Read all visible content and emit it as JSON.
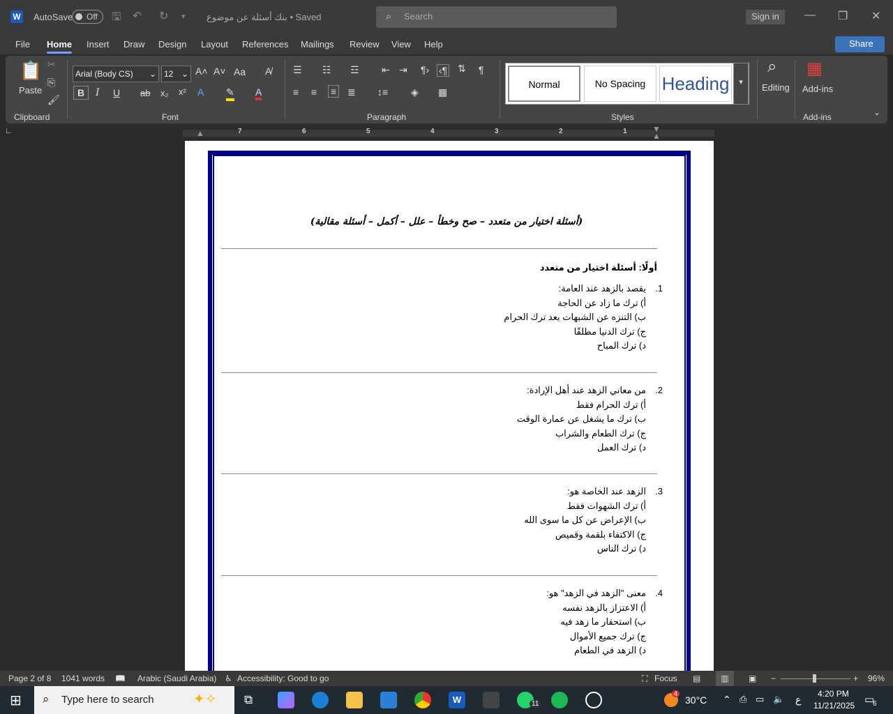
{
  "titlebar": {
    "autosave": "AutoSave",
    "toggle": "Off",
    "doc_title": "بنك أسئلة عن موضوع • Saved",
    "search_placeholder": "Search",
    "signin": "Sign in"
  },
  "menu": [
    "File",
    "Home",
    "Insert",
    "Draw",
    "Design",
    "Layout",
    "References",
    "Mailings",
    "Review",
    "View",
    "Help"
  ],
  "share": "Share",
  "ribbon": {
    "clipboard": {
      "label": "Clipboard",
      "paste": "Paste"
    },
    "font": {
      "label": "Font",
      "family": "Arial (Body CS)",
      "size": "12",
      "bold": "B",
      "italic": "I",
      "underline": "U",
      "strike": "ab",
      "sub": "x₂",
      "sup": "x²",
      "case": "Aa"
    },
    "paragraph": {
      "label": "Paragraph"
    },
    "styles": {
      "label": "Styles",
      "items": [
        "Normal",
        "No Spacing",
        "Heading"
      ]
    },
    "editing": "Editing",
    "addins": {
      "button": "Add-ins",
      "label": "Add-ins"
    }
  },
  "ruler": [
    "7",
    "6",
    "5",
    "4",
    "3",
    "2",
    "1"
  ],
  "document": {
    "heading": "(أسئلة اختيار من متعدد – صح وخطأ – علل – أكمل – أسئلة مقالية)",
    "section_title": "أولًا: أسئلة اختيار من متعدد",
    "questions": [
      {
        "num": "1.",
        "stem": "يقصد بالزهد عند العامة:",
        "options": [
          "أ) ترك ما زاد عن الحاجة",
          "ب) التنزه عن الشبهات بعد ترك الحرام",
          "ج) ترك الدنيا مطلقًا",
          "د) ترك المباح"
        ]
      },
      {
        "num": "2.",
        "stem": "من معاني الزهد عند أهل الإرادة:",
        "options": [
          "أ) ترك الحرام فقط",
          "ب) ترك ما يشغل عن عمارة الوقت",
          "ج) ترك الطعام والشراب",
          "د) ترك العمل"
        ]
      },
      {
        "num": "3.",
        "stem": "الزهد عند الخاصة هو:",
        "options": [
          "أ) ترك الشهوات فقط",
          "ب) الإعراض عن كل ما سوى الله",
          "ج) الاكتفاء بلقمة وقميص",
          "د) ترك الناس"
        ]
      },
      {
        "num": "4.",
        "stem": "معنى \"الزهد في الزهد\" هو:",
        "options": [
          "أ) الاعتزاز بالزهد نفسه",
          "ب) استحقار ما زهد فيه",
          "ج) ترك جميع الأموال",
          "د) الزهد في الطعام"
        ]
      }
    ]
  },
  "status": {
    "page": "Page 2 of 8",
    "words": "1041 words",
    "language": "Arabic (Saudi Arabia)",
    "accessibility": "Accessibility: Good to go",
    "focus": "Focus",
    "zoom": "96%"
  },
  "taskbar": {
    "search": "Type here to search",
    "whatsapp_badge": "11",
    "weather_badge": "4",
    "temp": "30°C",
    "lang": "ع",
    "time": "4:20 PM",
    "date": "11/21/2025",
    "notif": "6"
  }
}
